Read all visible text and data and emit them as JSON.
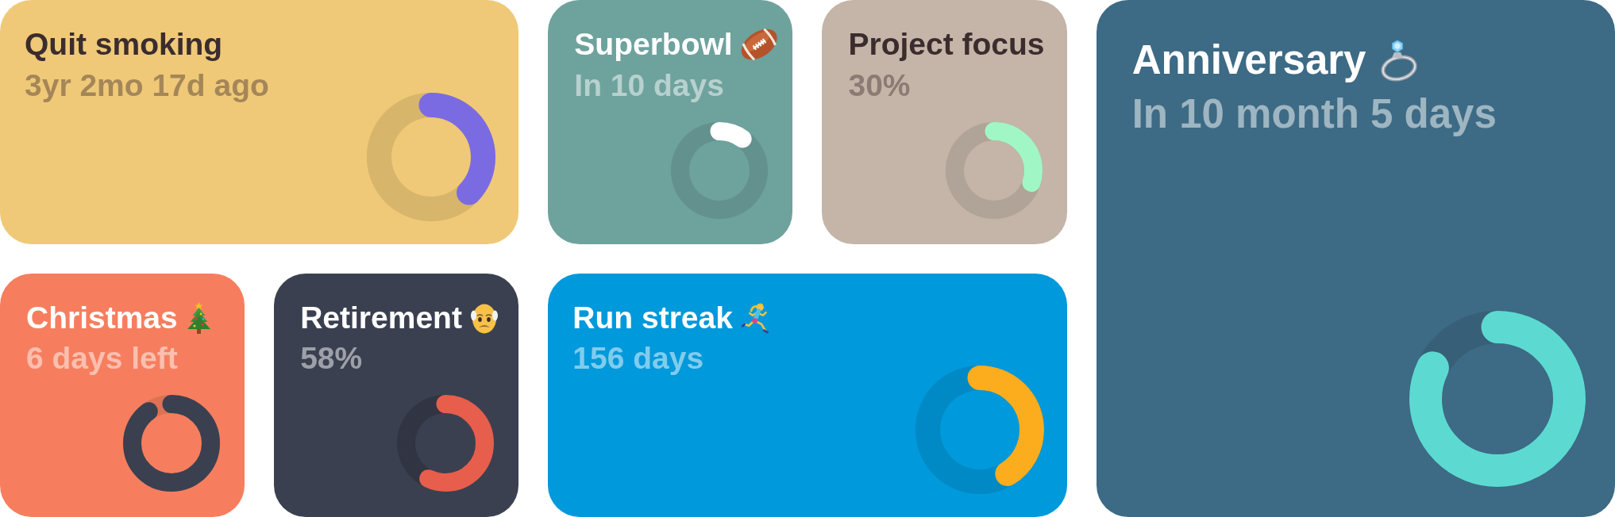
{
  "cards": [
    {
      "title": "Quit smoking",
      "subtitle": "3yr 2mo 17d ago",
      "color": "#efc977",
      "ring": {
        "level": 0.37,
        "color": "#7b6be2"
      }
    },
    {
      "title": "Superbowl",
      "subtitle": "In 10 days",
      "color": "#6ea29d",
      "ring": {
        "level": 0.1,
        "color": "#ffffff"
      }
    },
    {
      "title": "Project focus",
      "subtitle": "30%",
      "color": "#c4b5a8",
      "ring": {
        "level": 0.3,
        "color": "#a0f7c5"
      }
    },
    {
      "title": "Anniversary",
      "subtitle": "In 10 month 5 days",
      "color": "#3d6a84",
      "ring": {
        "level": 0.82,
        "color": "#5cdad2"
      }
    },
    {
      "title": "Christmas",
      "subtitle": "6 days left",
      "color": "#f67e5e",
      "ring": {
        "level": 0.9,
        "color": "#3a4050"
      }
    },
    {
      "title": "Retirement",
      "subtitle": "58%",
      "color": "#3b4050",
      "ring": {
        "level": 0.57,
        "color": "#e75e4c"
      }
    },
    {
      "title": "Run streak",
      "subtitle": "156 days",
      "color": "#0099db",
      "ring": {
        "level": 0.41,
        "color": "#fbad1e"
      }
    }
  ]
}
